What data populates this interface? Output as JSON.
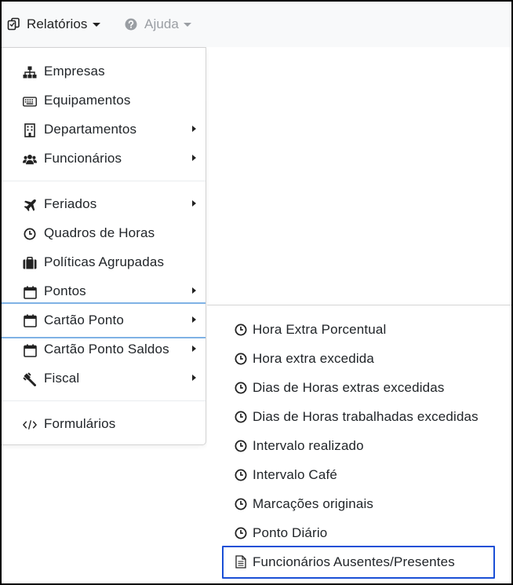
{
  "navbar": {
    "reports": {
      "label": "Relatórios",
      "icon": "copy-icon"
    },
    "help": {
      "label": "Ajuda",
      "icon": "question-circle-icon"
    }
  },
  "menu": {
    "items": [
      {
        "label": "Empresas",
        "icon": "sitemap-icon",
        "has_submenu": false
      },
      {
        "label": "Equipamentos",
        "icon": "keyboard-icon",
        "has_submenu": false
      },
      {
        "label": "Departamentos",
        "icon": "building-icon",
        "has_submenu": true
      },
      {
        "label": "Funcionários",
        "icon": "users-icon",
        "has_submenu": true
      },
      {
        "label": "Feriados",
        "icon": "plane-icon",
        "has_submenu": true
      },
      {
        "label": "Quadros de Horas",
        "icon": "clock-icon",
        "has_submenu": false
      },
      {
        "label": "Políticas Agrupadas",
        "icon": "briefcase-icon",
        "has_submenu": false
      },
      {
        "label": "Pontos",
        "icon": "calendar-icon",
        "has_submenu": true
      },
      {
        "label": "Cartão Ponto",
        "icon": "calendar-icon",
        "has_submenu": true,
        "active": true
      },
      {
        "label": "Cartão Ponto Saldos",
        "icon": "calendar-icon",
        "has_submenu": true
      },
      {
        "label": "Fiscal",
        "icon": "gavel-icon",
        "has_submenu": true
      },
      {
        "label": "Formulários",
        "icon": "code-icon",
        "has_submenu": false
      }
    ]
  },
  "submenu": {
    "items": [
      {
        "label": "Hora Extra Porcentual",
        "icon": "clock-icon"
      },
      {
        "label": "Hora extra excedida",
        "icon": "clock-icon"
      },
      {
        "label": "Dias de Horas extras excedidas",
        "icon": "clock-icon"
      },
      {
        "label": "Dias de Horas trabalhadas excedidas",
        "icon": "clock-icon"
      },
      {
        "label": "Intervalo realizado",
        "icon": "clock-icon"
      },
      {
        "label": "Intervalo Café",
        "icon": "clock-icon"
      },
      {
        "label": "Marcações originais",
        "icon": "clock-icon"
      },
      {
        "label": "Ponto Diário",
        "icon": "clock-icon"
      },
      {
        "label": "Funcionários Ausentes/Presentes",
        "icon": "file-text-icon",
        "focused": true
      }
    ]
  },
  "colors": {
    "focus_border": "#1a4fd6",
    "active_border": "#7fb2e5",
    "navbar_bg": "#f8f9fa",
    "muted_text": "#9a9ea3"
  }
}
